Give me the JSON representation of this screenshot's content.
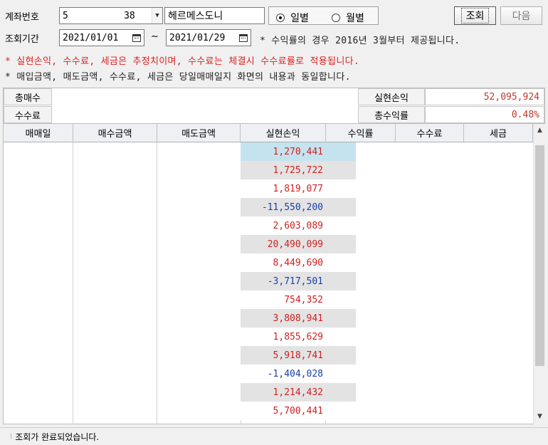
{
  "form": {
    "account_label": "계좌번호",
    "account_value": "5          38",
    "account_name": "헤르메스도니",
    "period_label": "조회기간",
    "date_from": "2021/01/01",
    "date_to": "2021/01/29",
    "tilde": "~",
    "radio_daily": "일별",
    "radio_monthly": "월별",
    "radio_selected": "daily",
    "btn_query": "조회",
    "btn_next": "다음",
    "note_period": "* 수익률의 경우 2016년 3월부터 제공됩니다.",
    "note_red": "* 실현손익, 수수료, 세금은 추정치이며, 수수료는 체결시 수수료률로 적용됩니다.",
    "note_gray": "* 매입금액, 매도금액, 수수료, 세금은 당일매매일지 화면의 내용과 동일합니다."
  },
  "summary": {
    "total_trades_label": "총매수",
    "total_trades_value": "",
    "fee_label": "수수료",
    "fee_value": "",
    "realized_pnl_label": "실현손익",
    "realized_pnl_value": "52,095,924",
    "total_return_label": "총수익률",
    "total_return_value": "0.48%"
  },
  "grid": {
    "headers": [
      "매매일",
      "매수금액",
      "매도금액",
      "실현손익",
      "수익률",
      "수수료",
      "세금"
    ],
    "pnl_rows": [
      "1,270,441",
      "1,725,722",
      "1,819,077",
      "-11,550,200",
      "2,603,089",
      "20,490,099",
      "8,449,690",
      "-3,717,501",
      "754,352",
      "3,808,941",
      "1,855,629",
      "5,918,741",
      "-1,404,028",
      "1,214,432",
      "5,700,441"
    ]
  },
  "status_bar": {
    "message": "조회가 완료되었습니다."
  },
  "colors": {
    "positive": "#d02020",
    "negative": "#1a3fa8",
    "selected_row": "#c5e3ee",
    "stripe": "#e3e3e3"
  }
}
